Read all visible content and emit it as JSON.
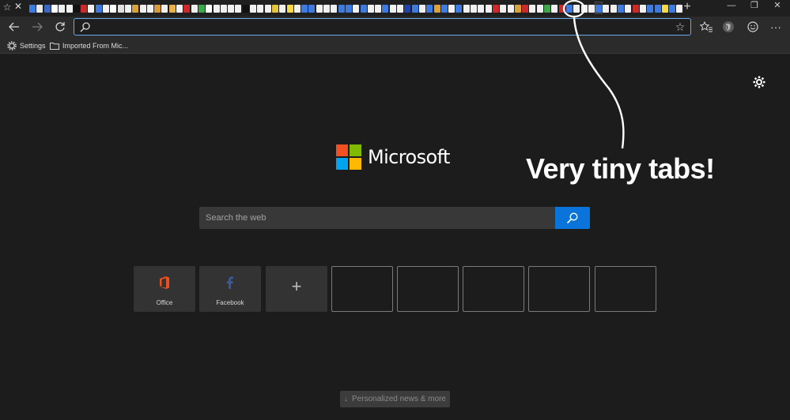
{
  "tabs": {
    "pinned_star_icon": "star-icon",
    "close_icon": "close-icon",
    "favicon_colors": [
      "#3d7be0",
      "#e8e8e8",
      "#3a67c4",
      "#ffffff",
      "#f0f0f0",
      "#f0f0f0",
      "#111111",
      "#cc2a2a",
      "#f0f0f0",
      "#3d7be0",
      "#f0f0f0",
      "#ffffff",
      "#e0e0e0",
      "#f0f0f0",
      "#d9a23b",
      "#f0f0f0",
      "#f0f0f0",
      "#d99a3b",
      "#f0f0f0",
      "#e8b14a",
      "#f0f0f0",
      "#cc2a2a",
      "#f0f0f0",
      "#3da84a",
      "#ffffff",
      "#f0f0f0",
      "#f0f0f0",
      "#f0f0f0",
      "#f0f0f0",
      "#111111",
      "#f0f0f0",
      "#f0f0f0",
      "#f0f0f0",
      "#e6c33b",
      "#f0f0f0",
      "#f5d94a",
      "#f0f0f0",
      "#3d7be0",
      "#3d7be0",
      "#f0f0f0",
      "#f0f0f0",
      "#f0f0f0",
      "#3d7be0",
      "#3d7be0",
      "#f0f0f0",
      "#3d7be0",
      "#f0f0f0",
      "#f0f0f0",
      "#3d7be0",
      "#f0f0f0",
      "#f0f0f0",
      "#2244aa",
      "#3d7be0",
      "#f0f0f0",
      "#3d7be0",
      "#d9a23b",
      "#3d7be0",
      "#f0f0f0",
      "#3d7be0",
      "#f0f0f0",
      "#f0f0f0",
      "#f0f0f0",
      "#f0f0f0",
      "#cc2a2a",
      "#f0f0f0",
      "#f0f0f0",
      "#d9a23b",
      "#cc2a2a",
      "#f0f0f0",
      "#f0f0f0",
      "#3da84a",
      "#f0f0f0",
      "#cc2a2a",
      "#3d7be0",
      "#f0f0f0",
      "#f0f0f0",
      "#f0f0f0",
      "#3d7be0",
      "#f0f0f0",
      "#f0f0f0",
      "#3d7be0",
      "#f0f0f0",
      "#cc2a2a",
      "#f0f0f0",
      "#3d7be0",
      "#3d7be0",
      "#f5d94a",
      "#3d7be0",
      "#f0f0f0"
    ],
    "active_index": 77,
    "new_tab_icon": "plus-icon"
  },
  "window_controls": {
    "minimize_icon": "minimize-icon",
    "restore_icon": "restore-icon",
    "close_icon": "close-icon"
  },
  "toolbar": {
    "address_value": "",
    "icons": [
      "back-icon",
      "forward-icon",
      "refresh-icon",
      "search-icon",
      "favorite-star-icon",
      "favorites-hub-icon",
      "profile-icon",
      "feedback-icon",
      "more-icon"
    ]
  },
  "favorites_bar": {
    "items": [
      {
        "label": "Settings",
        "icon": "gear-icon"
      },
      {
        "label": "Imported From Mic...",
        "icon": "folder-icon"
      }
    ]
  },
  "ntp": {
    "brand_text": "Microsoft",
    "brand_colors": [
      "#f25022",
      "#7fba00",
      "#00a4ef",
      "#ffb900"
    ],
    "search_placeholder": "Search the web",
    "accent": "#0a74da",
    "tiles": [
      {
        "label": "Office",
        "icon": "office-icon",
        "color": "#e8511f"
      },
      {
        "label": "Facebook",
        "icon": "facebook-icon",
        "color": "#3b5998"
      },
      {
        "label": "",
        "icon": "add-icon"
      },
      {
        "label": ""
      },
      {
        "label": ""
      },
      {
        "label": ""
      },
      {
        "label": ""
      },
      {
        "label": ""
      }
    ],
    "news_button": "Personalized news & more",
    "news_arrow": "↓"
  },
  "annotation": {
    "text": "Very tiny tabs!"
  }
}
